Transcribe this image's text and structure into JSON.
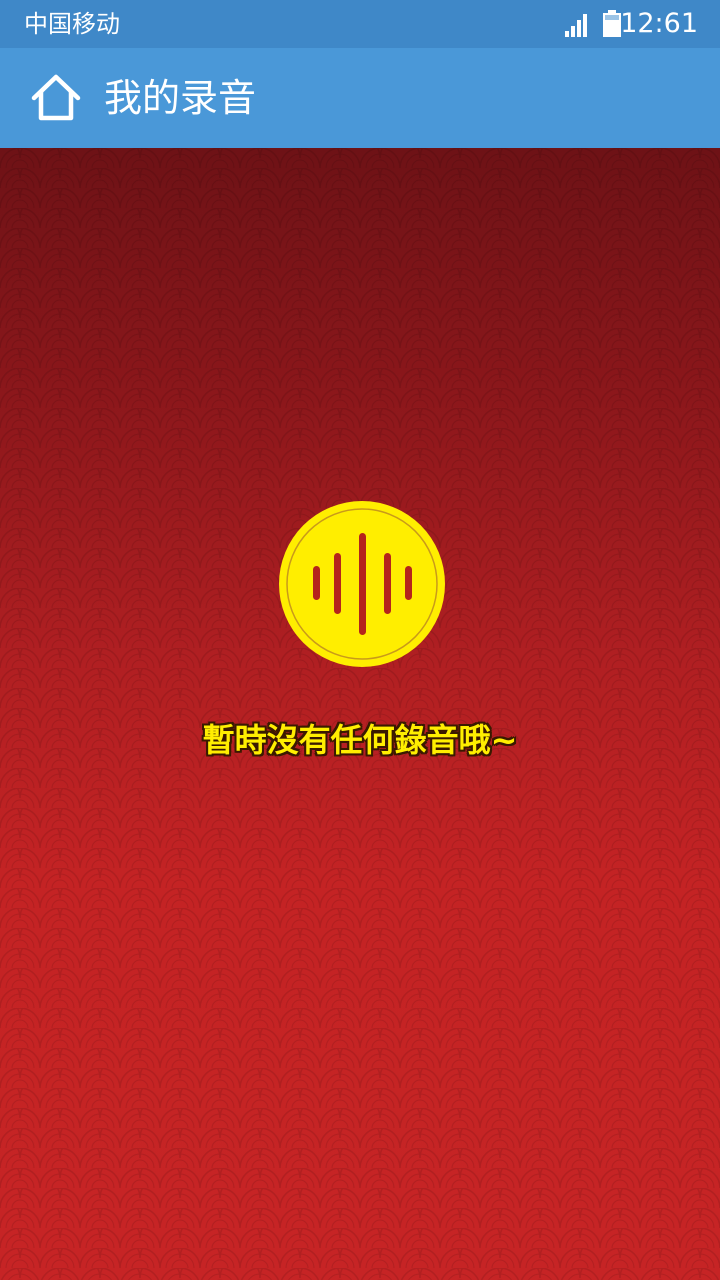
{
  "status_bar": {
    "carrier": "中国移动",
    "time": "12:61",
    "signal_icon": "signal-icon",
    "battery_icon": "battery-icon"
  },
  "app_bar": {
    "home_icon": "home-icon",
    "title": "我的录音"
  },
  "empty_state": {
    "icon": "sound-wave-icon",
    "message": "暫時沒有任何錄音哦~"
  },
  "colors": {
    "status_bar_bg": "#3f88c8",
    "app_bar_bg": "#4a98d8",
    "content_bg_top": "#6e1216",
    "content_bg_bottom": "#c62425",
    "icon_yellow": "#ffee00",
    "icon_wave": "#b5241c"
  }
}
